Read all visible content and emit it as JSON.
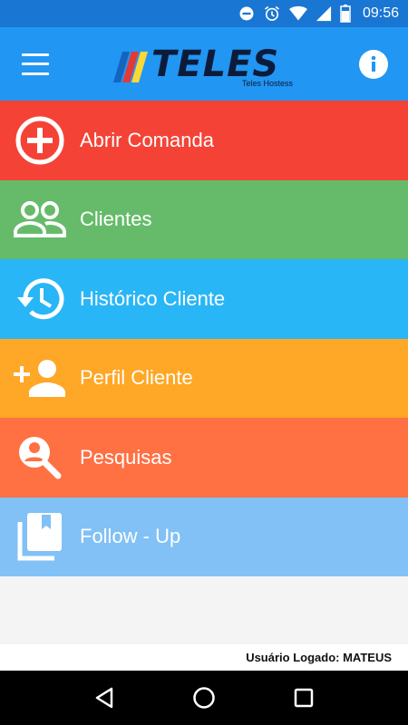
{
  "status_bar": {
    "time": "09:56",
    "icons": [
      "do-not-disturb-icon",
      "alarm-icon",
      "wifi-icon",
      "signal-icon",
      "battery-icon"
    ]
  },
  "app_bar": {
    "logo_text": "TELES",
    "logo_subtitle": "Teles Hostess",
    "menu_icon": "hamburger-menu-icon",
    "info_icon": "info-icon",
    "color": "#2196f3"
  },
  "menu": {
    "items": [
      {
        "label": "Abrir Comanda",
        "icon": "add-circle-icon",
        "color": "#f44336"
      },
      {
        "label": "Clientes",
        "icon": "people-icon",
        "color": "#66bb6a"
      },
      {
        "label": "Histórico Cliente",
        "icon": "history-icon",
        "color": "#29b6f6"
      },
      {
        "label": "Perfil Cliente",
        "icon": "person-add-icon",
        "color": "#ffa726"
      },
      {
        "label": "Pesquisas",
        "icon": "person-search-icon",
        "color": "#ff7043"
      },
      {
        "label": "Follow - Up",
        "icon": "library-books-icon",
        "color": "#81c1f5"
      }
    ]
  },
  "footer": {
    "logged_user": "Usuário Logado: MATEUS"
  },
  "nav_bar": {
    "buttons": [
      "back-icon",
      "home-icon",
      "recents-icon"
    ]
  }
}
